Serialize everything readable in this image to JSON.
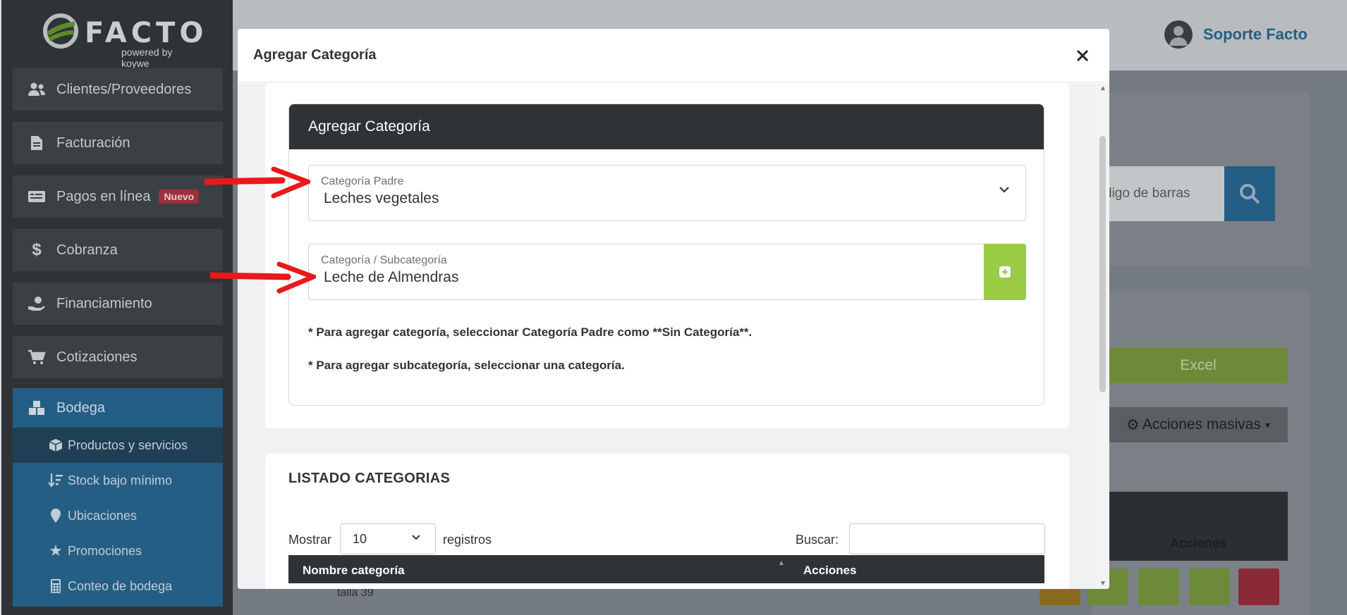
{
  "app": {
    "logo_text": "FACTO",
    "logo_sub": "powered by koywe",
    "user_name": "Soporte Facto"
  },
  "sidebar": {
    "items": [
      {
        "label": "Clientes/Proveedores",
        "icon": "users-icon"
      },
      {
        "label": "Facturación",
        "icon": "document-icon"
      },
      {
        "label": "Pagos en línea",
        "icon": "payment-card-icon",
        "badge": "Nuevo"
      },
      {
        "label": "Cobranza",
        "icon": "dollar-icon"
      },
      {
        "label": "Financiamiento",
        "icon": "hand-money-icon"
      },
      {
        "label": "Cotizaciones",
        "icon": "cart-icon"
      }
    ],
    "bodega": {
      "label": "Bodega",
      "children": [
        {
          "label": "Productos y servicios",
          "icon": "box-icon",
          "active": true
        },
        {
          "label": "Stock bajo mínimo",
          "icon": "sort-down-icon"
        },
        {
          "label": "Ubicaciones",
          "icon": "map-pin-icon"
        },
        {
          "label": "Promociones",
          "icon": "star-icon"
        },
        {
          "label": "Conteo de bodega",
          "icon": "calculator-icon"
        }
      ]
    }
  },
  "background": {
    "barcode_placeholder": "digo de barras",
    "excel_label": "Excel",
    "bulk_actions_label": "Acciones masivas",
    "table_actions_header": "Acciones",
    "row_text": "talla 39"
  },
  "modal": {
    "title": "Agregar Categoría",
    "card_title": "Agregar Categoría",
    "parent_field": {
      "label": "Categoría Padre",
      "value": "Leches vegetales"
    },
    "sub_field": {
      "label": "Categoría / Subcategoría",
      "value": "Leche de Almendras"
    },
    "notes": [
      "* Para agregar categoría, seleccionar Categoría Padre como **Sin Categoría**.",
      "* Para agregar subcategoría, seleccionar una categoría."
    ],
    "list": {
      "title": "LISTADO CATEGORIAS",
      "show_label": "Mostrar",
      "page_length": "10",
      "records_label": "registros",
      "search_label": "Buscar:",
      "columns": [
        "Nombre categoría",
        "Acciones"
      ]
    }
  },
  "colors": {
    "sidebar_bg": "#2f3336",
    "active_blue": "#2a77b0",
    "add_green": "#9acb46",
    "annotation_red": "#e8191a"
  }
}
